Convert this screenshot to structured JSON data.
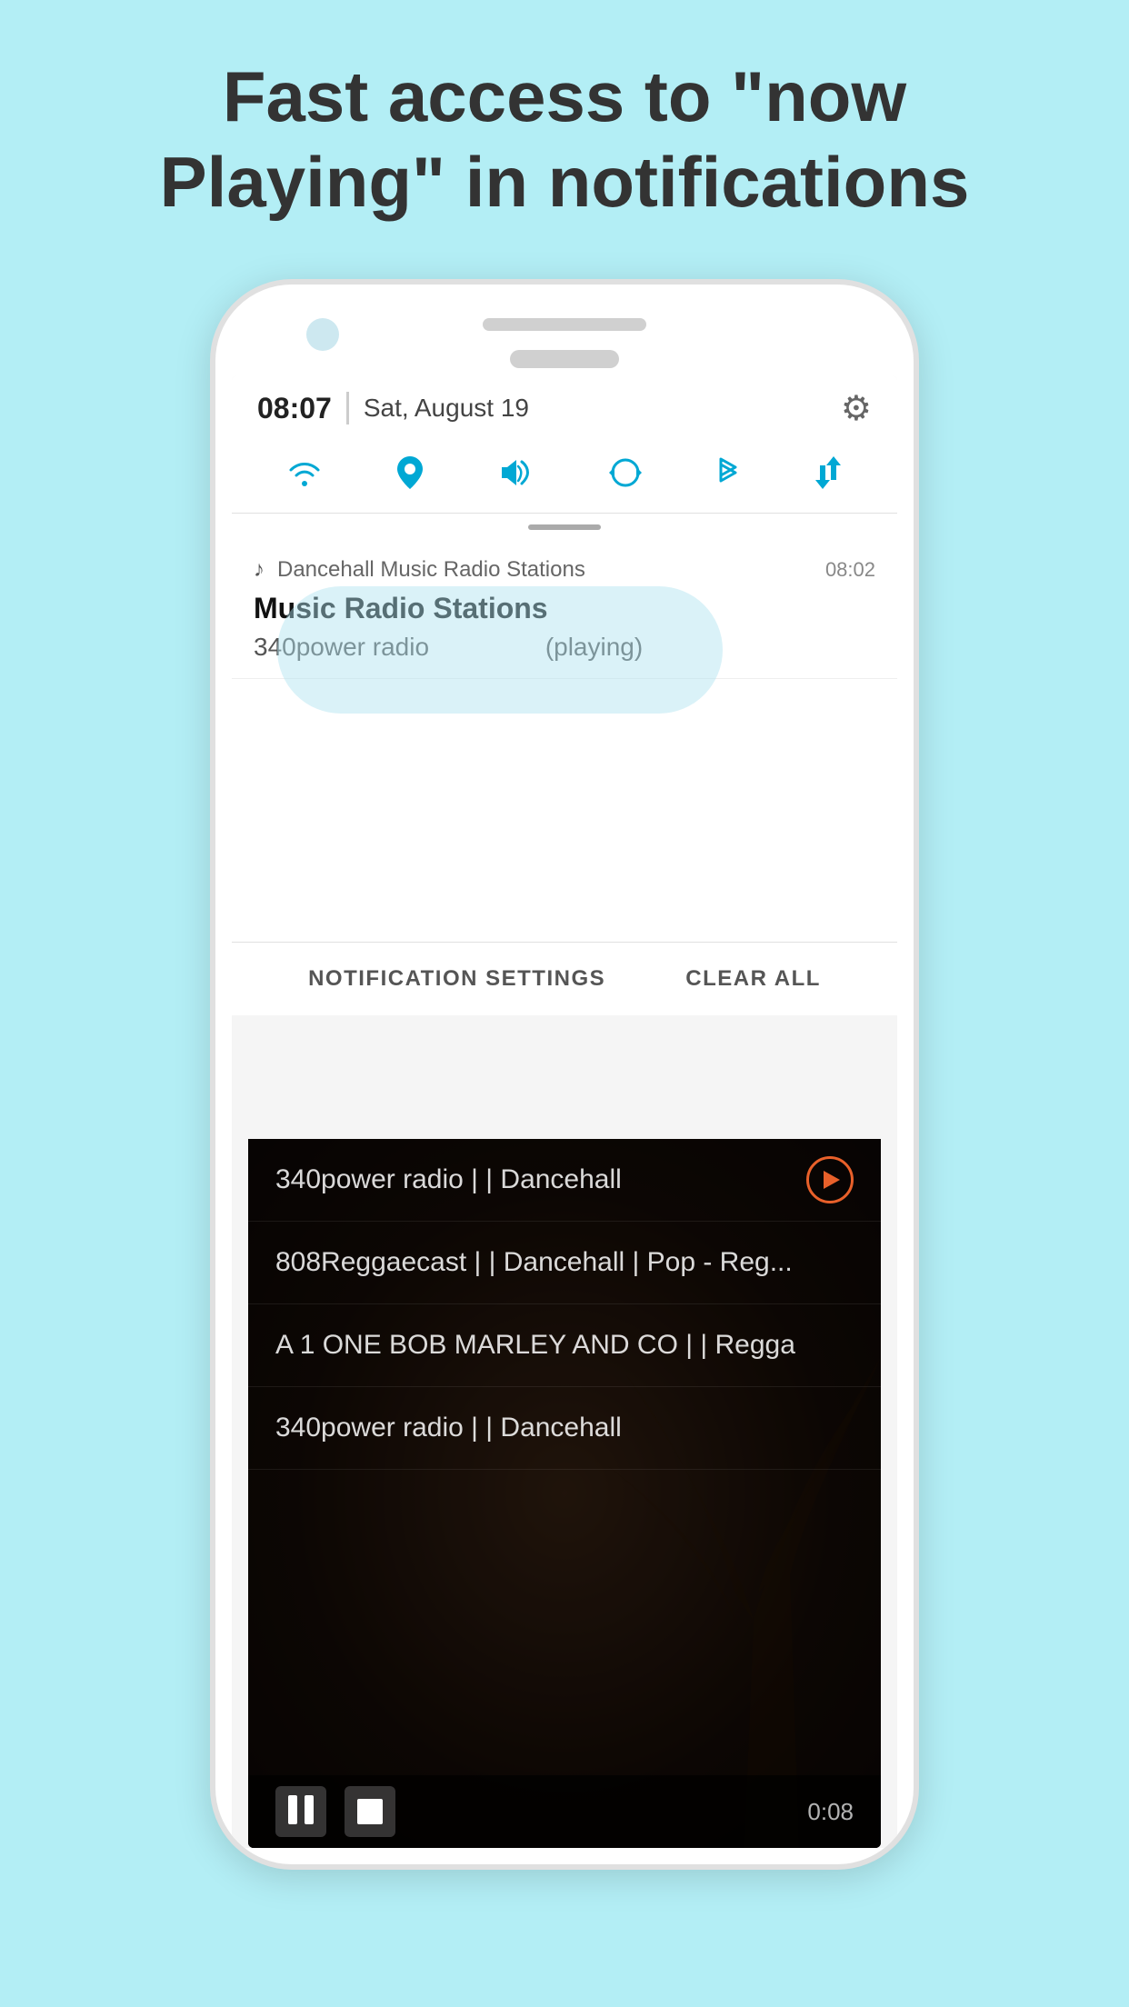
{
  "headline": {
    "line1": "Fast access to \"now",
    "line2": "Playing\" in notifications"
  },
  "statusBar": {
    "time": "08:07",
    "divider": "|",
    "date": "Sat, August 19",
    "gearIcon": "⚙"
  },
  "quickSettings": {
    "icons": [
      {
        "name": "wifi-icon",
        "symbol": "📶"
      },
      {
        "name": "location-icon",
        "symbol": "📍"
      },
      {
        "name": "volume-icon",
        "symbol": "🔊"
      },
      {
        "name": "sync-icon",
        "symbol": "🔄"
      },
      {
        "name": "bluetooth-icon",
        "symbol": "🔵"
      },
      {
        "name": "data-transfer-icon",
        "symbol": "⇅"
      }
    ]
  },
  "notification": {
    "appIcon": "♪",
    "appName": "Dancehall Music Radio Stations",
    "time": "08:02",
    "title": "Music Radio Stations",
    "subtitle": "340power radio",
    "status": "(playing)"
  },
  "notificationActions": {
    "settings": "NOTIFICATION SETTINGS",
    "clear": "CLEAR ALL"
  },
  "appList": {
    "items": [
      {
        "text": "340power radio | | Dancehall",
        "hasPlay": true
      },
      {
        "text": "808Reggaecast | | Dancehall | Pop - Reg...",
        "hasPlay": false
      },
      {
        "text": "A 1 ONE BOB MARLEY AND CO | | Regga",
        "hasPlay": false
      },
      {
        "text": "340power radio | | Dancehall",
        "hasPlay": false
      }
    ]
  },
  "playback": {
    "time": "0:08"
  }
}
